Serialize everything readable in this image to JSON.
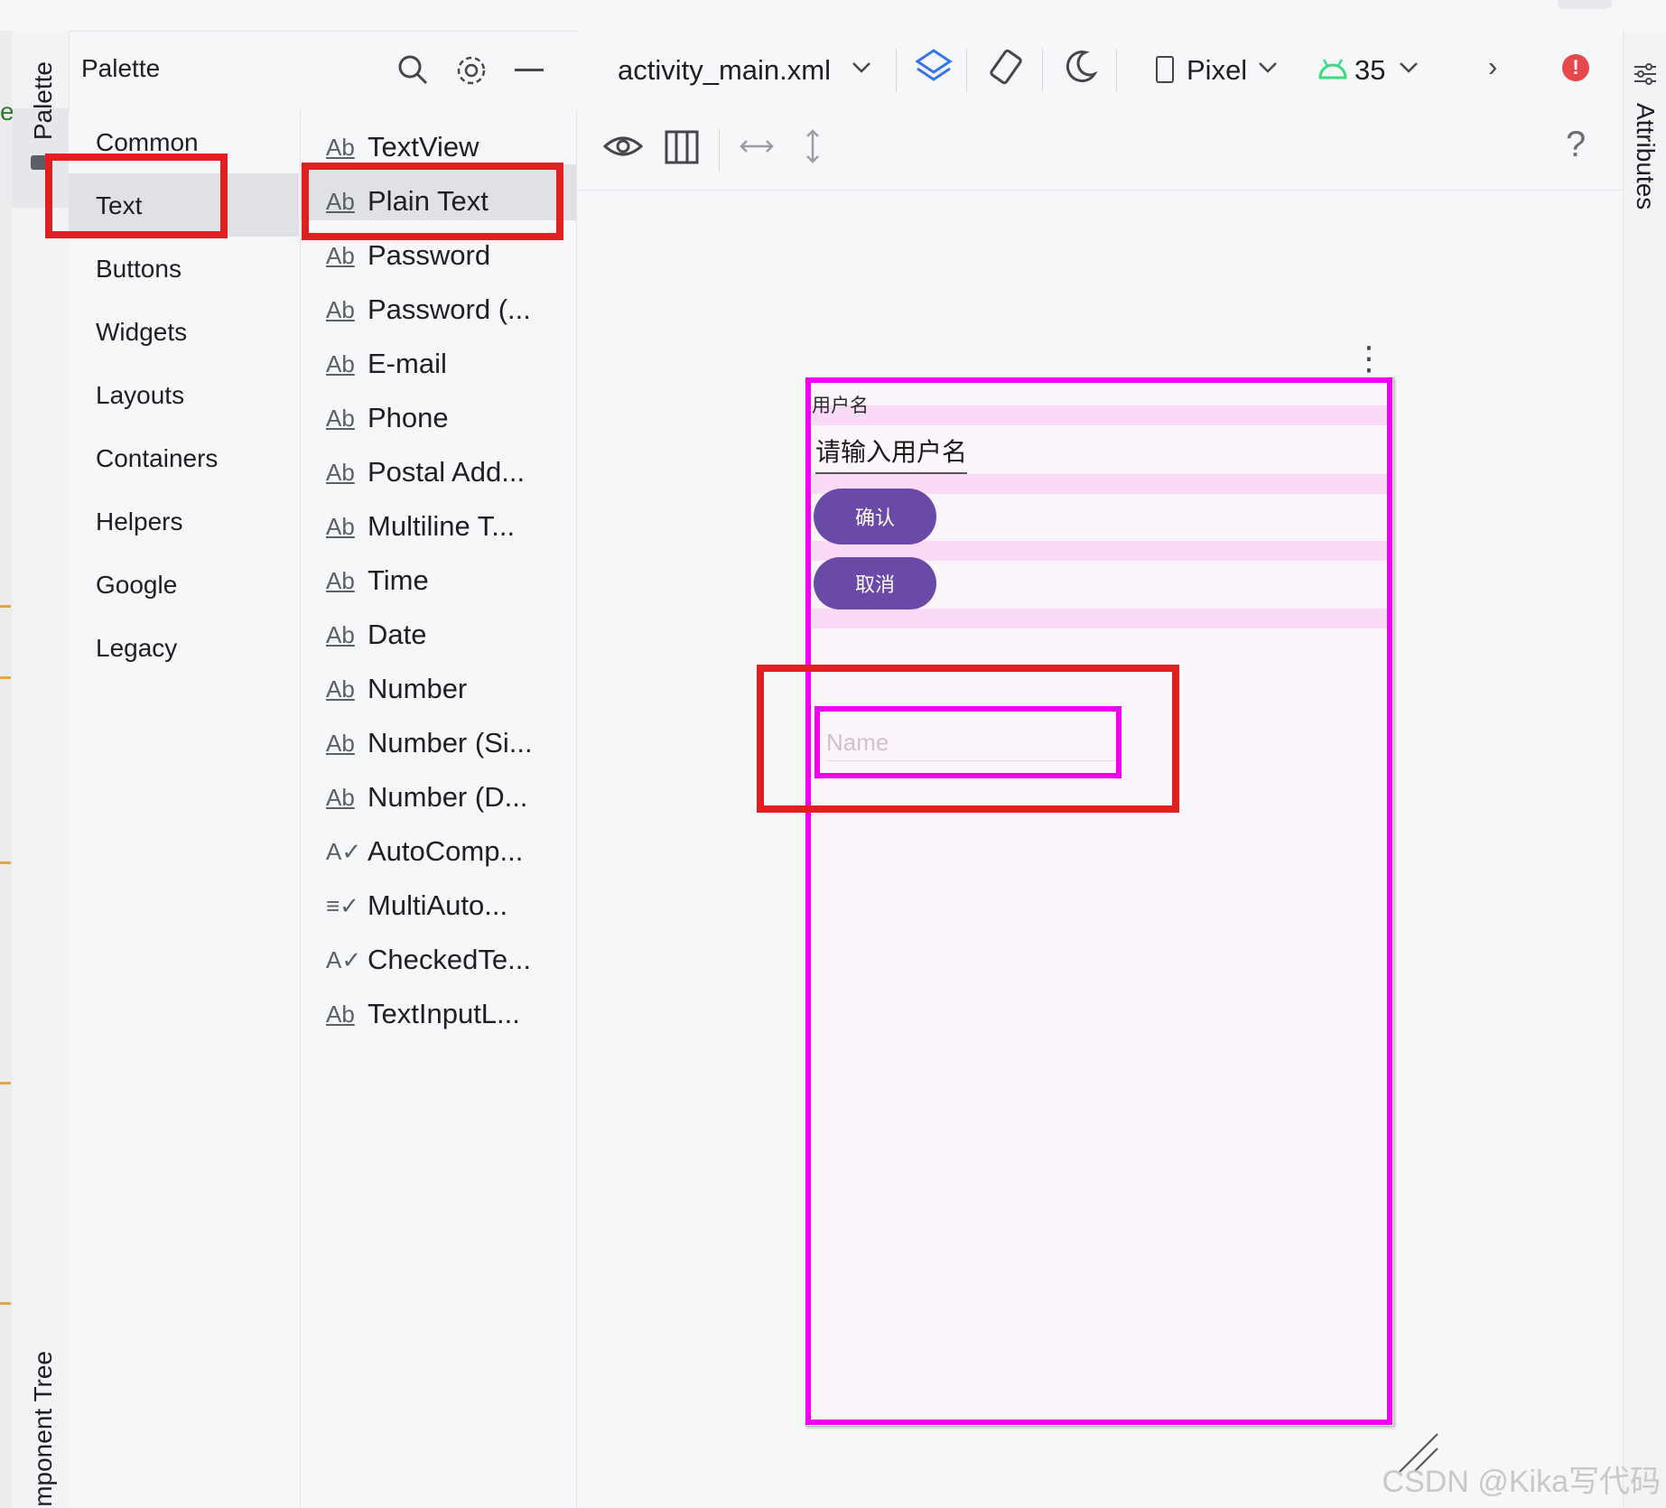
{
  "palette": {
    "rail_label": "Palette",
    "title": "Palette",
    "icons": [
      "search-icon",
      "gear-icon",
      "minimize-icon"
    ],
    "categories": [
      "Common",
      "Text",
      "Buttons",
      "Widgets",
      "Layouts",
      "Containers",
      "Helpers",
      "Google",
      "Legacy"
    ],
    "selected_category": "Text",
    "items": [
      {
        "icon": "Ab",
        "label": "TextView"
      },
      {
        "icon": "Ab",
        "label": "Plain Text"
      },
      {
        "icon": "Ab",
        "label": "Password"
      },
      {
        "icon": "Ab",
        "label": "Password (..."
      },
      {
        "icon": "Ab",
        "label": "E-mail"
      },
      {
        "icon": "Ab",
        "label": "Phone"
      },
      {
        "icon": "Ab",
        "label": "Postal Add..."
      },
      {
        "icon": "Ab",
        "label": "Multiline T..."
      },
      {
        "icon": "Ab",
        "label": "Time"
      },
      {
        "icon": "Ab",
        "label": "Date"
      },
      {
        "icon": "Ab",
        "label": "Number"
      },
      {
        "icon": "Ab",
        "label": "Number (Si..."
      },
      {
        "icon": "Ab",
        "label": "Number (D..."
      },
      {
        "icon": "A✓",
        "label": "AutoComp..."
      },
      {
        "icon": "≡✓",
        "label": "MultiAuto..."
      },
      {
        "icon": "A✓",
        "label": "CheckedTe..."
      },
      {
        "icon": "Ab",
        "label": "TextInputL..."
      }
    ],
    "selected_item": "Plain Text",
    "component_tree_label": "mponent Tree",
    "left_edge_letter": "e"
  },
  "toolbar": {
    "file": "activity_main.xml",
    "device": "Pixel",
    "api": "35",
    "more": "›",
    "help": "?",
    "error_icon": "error-icon"
  },
  "attributes_label": "Attributes",
  "phone": {
    "label_text": "用户名",
    "edit_text": "请输入用户名",
    "confirm_button": "确认",
    "cancel_button": "取消",
    "new_field_hint": "Name",
    "overflow": "⋮"
  },
  "watermark": "CSDN @Kika写代码",
  "colors": {
    "highlight_red": "#e02020",
    "selection_magenta": "#f000f0",
    "button_purple": "#6a4aa6",
    "android_green": "#3ddc84",
    "error_red": "#e5484d"
  }
}
